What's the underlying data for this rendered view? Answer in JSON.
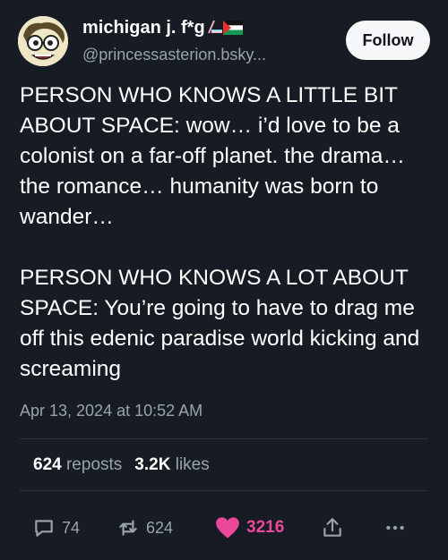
{
  "author": {
    "display_name": "michigan j. f*g",
    "flag_icons": [
      "trans-flag-icon",
      "palestine-flag-icon"
    ],
    "handle": "@princessasterion.bsky...",
    "avatar_icon": "cartoon-face-avatar"
  },
  "follow_label": "Follow",
  "post": {
    "paragraphs": [
      "PERSON WHO KNOWS A LITTLE BIT ABOUT SPACE: wow… i’d love to be a colonist on a far-off planet. the drama… the romance… humanity was born to wander…",
      "PERSON WHO KNOWS A LOT ABOUT SPACE: You’re going to have to drag me off this edenic paradise world kicking and screaming"
    ],
    "timestamp": "Apr 13, 2024 at 10:52 AM"
  },
  "stats": {
    "reposts_count": "624",
    "reposts_label": "reposts",
    "likes_count": "3.2K",
    "likes_label": "likes"
  },
  "actions": {
    "reply_count": "74",
    "repost_count": "624",
    "like_count": "3216",
    "icons": [
      "reply-icon",
      "repost-icon",
      "heart-icon",
      "share-icon",
      "more-icon"
    ]
  },
  "colors": {
    "background": "#171c24",
    "text": "#ffffff",
    "muted": "#9aa3ad",
    "like": "#ec4899",
    "follow_bg": "#f6f7f9"
  }
}
